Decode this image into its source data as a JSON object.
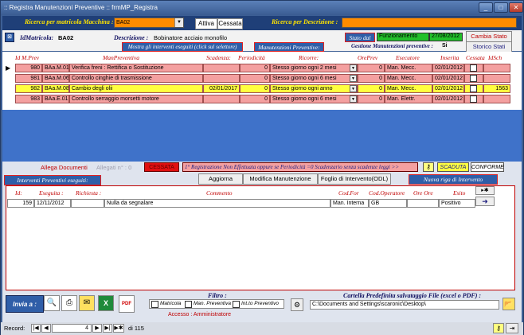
{
  "window": {
    "title": ":: Registra Manutenzioni Preventive ::   frmMP_Registra"
  },
  "header": {
    "ricerca_matricola_label": "Ricerca per matricola Macchina :",
    "matricola_value": "BA02",
    "tab_attiva": "Attiva",
    "tab_cessata": "Cessata",
    "ricerca_descrizione_label": "Ricerca per Descrizione :",
    "descrizione_search_value": ""
  },
  "info": {
    "idmatricola_label": "IdMatricola:",
    "idmatricola_value": "BA02",
    "descrizione_label": "Descrizione :",
    "descrizione_value": "Bobinatore acciaio monofilo",
    "stato_label": "Stato dal",
    "stato_value": "Funzionamento",
    "stato_date": "27/08/2012",
    "cambia_stato": "Cambia Stato",
    "mostra_label": "Mostra gli interventi eseguiti (click sul selettore)",
    "manutenzioni_label": "Manutenzioni Preventive:",
    "gestione_label": "Gestione Manutenzioni preventive :",
    "gestione_value": "Si",
    "storico_stati": "Storico Stati"
  },
  "grid": {
    "headers": [
      "Id M.Prev",
      "ManPreventiva",
      "Scadenza:",
      "Periodicità",
      "Ricorre:",
      "OrePrev",
      "Esecutore",
      "Inserita",
      "Cessata",
      "IdSch"
    ],
    "rows": [
      {
        "id": "980",
        "code": "BAa.M.01",
        "desc": "Verifica freni : Rettifica o Sostituzione",
        "scad": "",
        "per": "0",
        "ric": "Stesso giorno  ogni 2 mesi",
        "ore": "0",
        "esec": "Man. Mecc.",
        "ins": "02/01/2012",
        "idsch": "",
        "color": "#f4a0a0"
      },
      {
        "id": "981",
        "code": "BAa.M.06",
        "desc": "Controllo cinghie di trasmissione",
        "scad": "",
        "per": "0",
        "ric": "Stesso giorno  ogni 6 mesi",
        "ore": "0",
        "esec": "Man. Mecc.",
        "ins": "02/01/2012",
        "idsch": "",
        "color": "#f4a0a0"
      },
      {
        "id": "982",
        "code": "BAa.M.08",
        "desc": "Cambio degli olii",
        "scad": "02/01/2017",
        "per": "0",
        "ric": "Stesso giorno  ogni anno",
        "ore": "0",
        "esec": "Man. Mecc.",
        "ins": "02/01/2012",
        "idsch": "1563",
        "color": "#ffff40"
      },
      {
        "id": "983",
        "code": "BAa.E.01",
        "desc": "Controllo serraggio morsetti motore",
        "scad": "",
        "per": "0",
        "ric": "Stesso giorno  ogni 6 mesi",
        "ore": "0",
        "esec": "Man. Elettr.",
        "ins": "02/01/2012",
        "idsch": "",
        "color": "#f4a0a0"
      }
    ]
  },
  "midbar": {
    "allega": "Allega Documenti",
    "allegati": "Allegati n° : 0",
    "cessata": "CESSATA",
    "note": "1° Registrazione Non Effettuata  oppure  se Periodicità =0  Scadenzario senza scadenze leggi >>",
    "scaduta": "SCADUTA",
    "conforme": "CONFORME"
  },
  "sub": {
    "interventi_label": "Interventi Preventivi eseguiti:",
    "aggiorna": "Aggiorna",
    "modifica": "Modifica Manutenzione",
    "foglio": "Foglio di Intervento(ODL)",
    "nuova": "Nuova riga di Intervento",
    "headers": [
      "Id:",
      "Eseguita :",
      "Richiesta :",
      "Commento",
      "Cod.For",
      "Cod.Operatore",
      "Ore Ore",
      "Esito"
    ],
    "row": {
      "id": "159",
      "eseguita": "12/11/2012",
      "richiesta": "",
      "commento": "Nulla da segnalare",
      "codfor": "Man. Interna",
      "codop": "GB",
      "ore": "",
      "esito": "Positivo"
    }
  },
  "footer": {
    "invia": "Invia a :",
    "filtro": "Filtro :",
    "f_matricola": "Matricola",
    "f_manprev": "Man. Preventiva",
    "f_intsch": "Int.to Preventivo",
    "accesso": "Accesso : Amministratore",
    "cartella_label": "Cartella Predefinita  salvataggio File (excel o PDF) :",
    "cartella_value": "C:\\Documents and Settings\\scaronic\\Desktop\\"
  },
  "statusbar": {
    "record_label": "Record:",
    "record_value": "4",
    "total": "di 115"
  },
  "colors": {
    "accent": "#ff8c00",
    "row_pink": "#f4a0a0",
    "row_yellow": "#ffff40",
    "header_blue": "#1f3f78"
  }
}
